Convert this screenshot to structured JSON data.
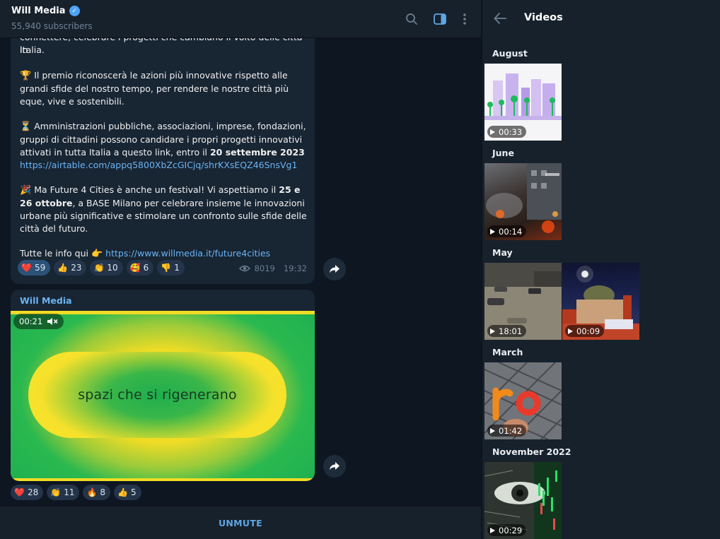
{
  "header": {
    "channel_name": "Will Media",
    "verified_mark": "✓",
    "subscribers": "55,940 subscribers",
    "icons": [
      "search-icon",
      "sidebar-toggle-icon",
      "more-vertical-icon"
    ]
  },
  "message1": {
    "cut_line": "connettere, celebrare i progetti che cambiano il volto delle città in",
    "line_italia": "Italia.",
    "p_award_emoji": "🏆",
    "p_award": "Il premio riconoscerà le azioni più innovative rispetto alle grandi sfide del nostro tempo, per rendere le nostre città più eque, vive e sostenibili.",
    "p_apply_emoji": "⏳",
    "p_apply": "Amministrazioni pubbliche, associazioni, imprese, fondazioni, gruppi di cittadini possono candidare i propri progetti innovativi attivati in tutta Italia a questo link, entro il ",
    "p_apply_date": "20 settembre 2023",
    "p_apply_link": "https://airtable.com/appq5800XbZcGICjq/shrKXsEQZ46SnsVg1",
    "p_festival_emoji": "🎉",
    "p_festival_a": "Ma Future 4 Cities è anche un festival! Vi aspettiamo il ",
    "p_festival_date": "25 e 26 ottobre",
    "p_festival_b": ", a BASE Milano per celebrare insieme le innovazioni urbane più significative e stimolare un confronto sulle sfide delle città del futuro.",
    "p_info": "Tutte le info qui ",
    "p_info_emoji": "👉",
    "p_info_link": "https://www.willmedia.it/future4cities",
    "reactions": [
      {
        "emoji": "❤️",
        "count": "59"
      },
      {
        "emoji": "👍",
        "count": "23"
      },
      {
        "emoji": "👏",
        "count": "10"
      },
      {
        "emoji": "🥰",
        "count": "6"
      },
      {
        "emoji": "👎",
        "count": "1"
      }
    ],
    "views": "8019",
    "time": "19:32"
  },
  "message2": {
    "sender": "Will Media",
    "video_text": "spazi che si rigenerano",
    "video_time": "00:21",
    "reactions": [
      {
        "emoji": "❤️",
        "count": "28"
      },
      {
        "emoji": "👏",
        "count": "11"
      },
      {
        "emoji": "🔥",
        "count": "8"
      },
      {
        "emoji": "👍",
        "count": "5"
      }
    ]
  },
  "bottom": {
    "unmute_label": "UNMUTE"
  },
  "panel": {
    "title": "Videos",
    "groups": [
      {
        "month": "August",
        "videos": [
          {
            "duration": "00:33"
          }
        ]
      },
      {
        "month": "June",
        "videos": [
          {
            "duration": "00:14"
          }
        ]
      },
      {
        "month": "May",
        "videos": [
          {
            "duration": "18:01"
          },
          {
            "duration": "00:09"
          }
        ]
      },
      {
        "month": "March",
        "videos": [
          {
            "duration": "01:42"
          }
        ]
      },
      {
        "month": "November 2022",
        "videos": [
          {
            "duration": "00:29"
          }
        ]
      }
    ]
  },
  "colors": {
    "bg": "#0e1621",
    "panel": "#17212b",
    "bubble": "#182533",
    "accent": "#6ab3f3",
    "reaction_bg": "#2b5278"
  }
}
